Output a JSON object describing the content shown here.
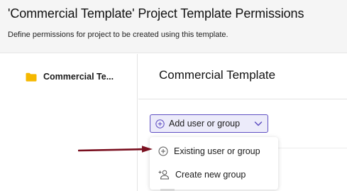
{
  "header": {
    "title": "'Commercial Template' Project Template Permissions",
    "subtitle": "Define permissions for project to be created using this template."
  },
  "sidebar": {
    "items": [
      {
        "label": "Commercial Te...",
        "icon": "folder-icon",
        "icon_color": "#f5b800"
      }
    ]
  },
  "main": {
    "project_title": "Commercial Template",
    "add_button": {
      "label": "Add user or group",
      "icon": "plus-circle-icon",
      "chevron": "chevron-down-icon",
      "accent_color": "#5f4fc2",
      "fill_color": "#ecebfa"
    },
    "dropdown": {
      "items": [
        {
          "label": "Existing user or group",
          "icon": "plus-circle-icon"
        },
        {
          "label": "Create new group",
          "icon": "add-user-icon"
        }
      ]
    }
  },
  "annotation": {
    "arrow_color": "#7a1020",
    "icon": "arrow-right-icon"
  }
}
